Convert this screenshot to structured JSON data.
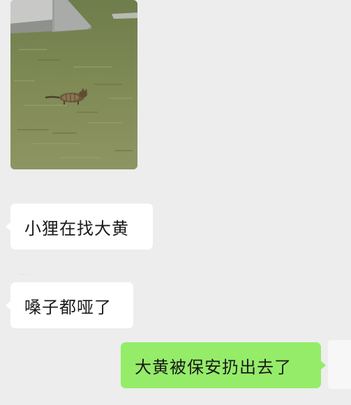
{
  "chat": {
    "background_color": "#ededed",
    "incoming_bubble_color": "#ffffff",
    "outgoing_bubble_color": "#95ec69",
    "messages": [
      {
        "type": "image",
        "direction": "incoming",
        "content": "photo of a tabby cat on grass"
      },
      {
        "type": "text",
        "direction": "incoming",
        "text": "小狸在找大黄"
      },
      {
        "type": "text",
        "direction": "incoming",
        "text": "嗓子都哑了"
      },
      {
        "type": "text",
        "direction": "outgoing",
        "text": "大黄被保安扔出去了"
      }
    ]
  }
}
